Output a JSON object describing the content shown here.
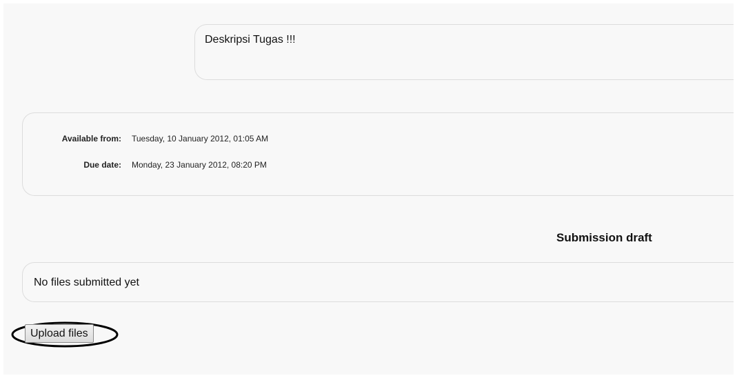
{
  "description": {
    "text": "Deskripsi Tugas !!!"
  },
  "dates": {
    "available_label": "Available from:",
    "available_value": "Tuesday, 10 January 2012, 01:05 AM",
    "due_label": "Due date:",
    "due_value": "Monday, 23 January 2012, 08:20 PM"
  },
  "submission": {
    "heading": "Submission draft",
    "status_text": "No files submitted yet",
    "upload_label": "Upload files"
  },
  "annotation": {
    "highlight_color": "#000000"
  }
}
